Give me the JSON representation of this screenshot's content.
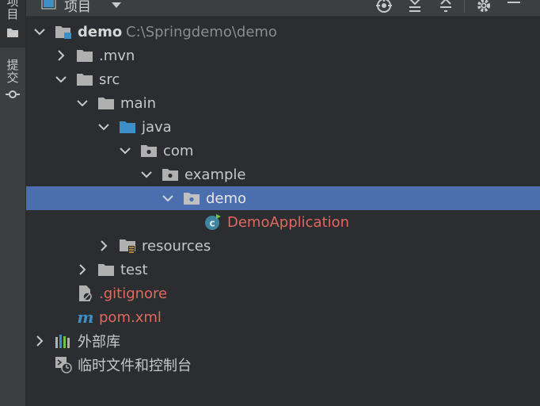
{
  "sidebar": {
    "tabs": [
      {
        "label": "项目"
      },
      {
        "label": "提交"
      }
    ]
  },
  "toolbar": {
    "title": "项目",
    "icons": [
      "folder-icon",
      "dropdown-arrow-icon",
      "locate-icon",
      "expand-all-icon",
      "collapse-all-icon",
      "settings-gear-icon",
      "minimize-icon"
    ]
  },
  "tree": {
    "rows": [
      {
        "label": "demo",
        "path": "C:\\Springdemo\\demo"
      },
      {
        "label": ".mvn"
      },
      {
        "label": "src"
      },
      {
        "label": "main"
      },
      {
        "label": "java"
      },
      {
        "label": "com"
      },
      {
        "label": "example"
      },
      {
        "label": "demo"
      },
      {
        "label": "DemoApplication"
      },
      {
        "label": "resources"
      },
      {
        "label": "test"
      },
      {
        "label": ".gitignore"
      },
      {
        "label": "pom.xml"
      },
      {
        "label": "外部库"
      },
      {
        "label": "临时文件和控制台"
      }
    ]
  },
  "colors": {
    "background": "#2b2d30",
    "selection": "#4b6eaf",
    "untracked_file": "#e0685e",
    "source_folder": "#3d8fc8",
    "text": "#c7c7c7"
  }
}
